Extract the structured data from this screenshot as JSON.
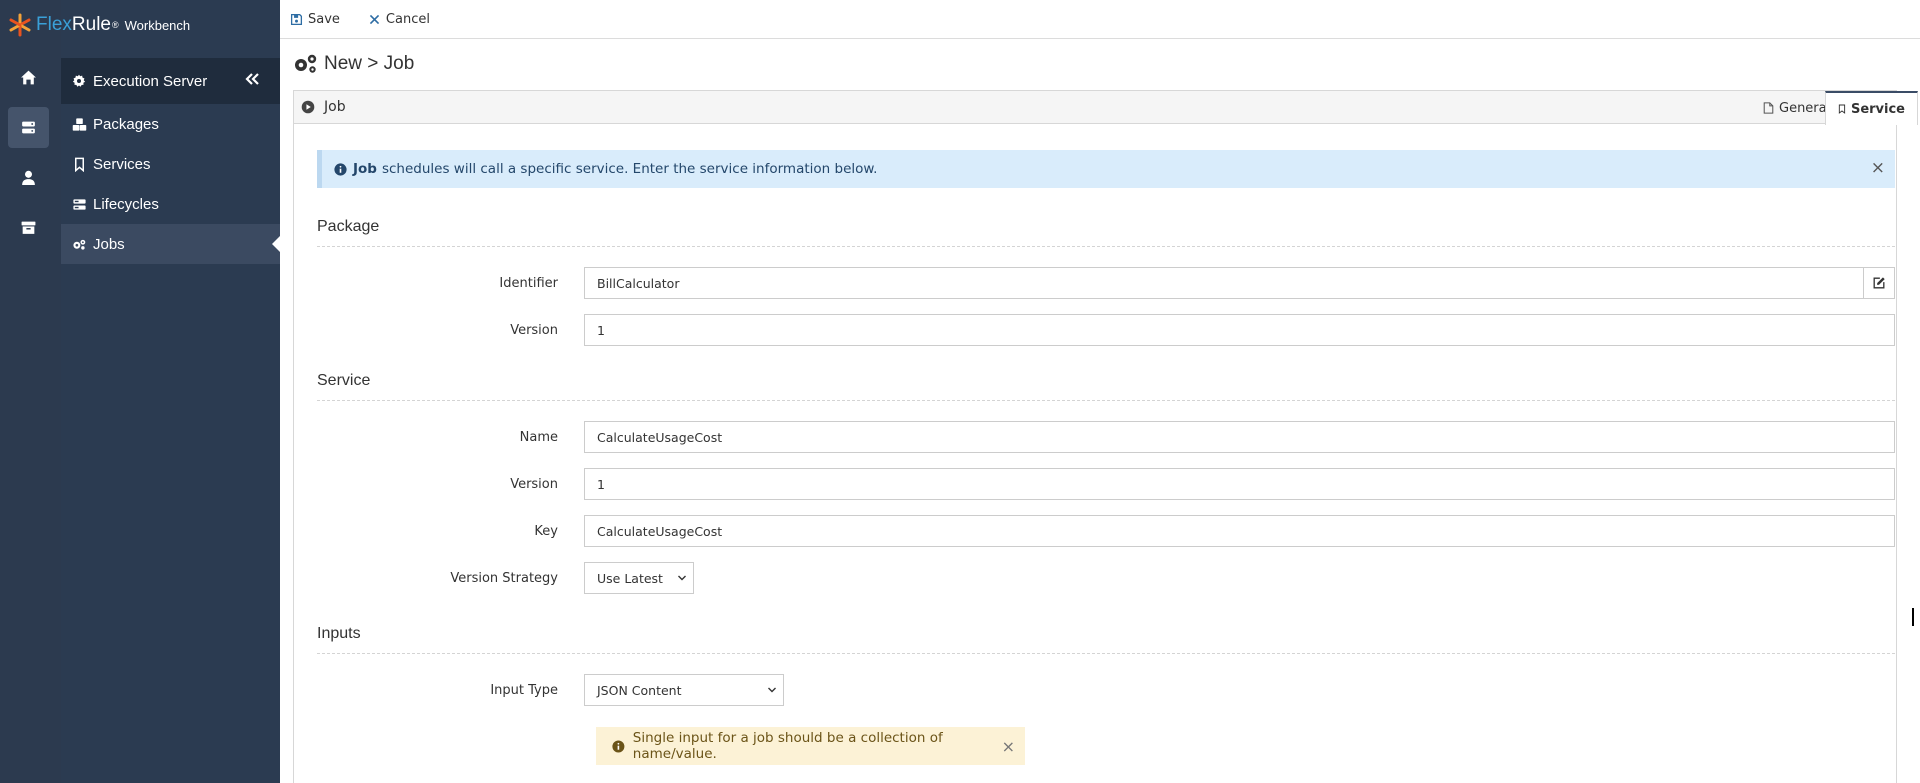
{
  "brand": {
    "name_flex": "Flex",
    "name_rule": "Rule",
    "registered": "®",
    "product": "Workbench"
  },
  "rail": {
    "items": [
      "home-icon",
      "server-icon",
      "user-icon",
      "archive-icon"
    ],
    "active_index": 1
  },
  "sidebar": {
    "header": "Execution Server",
    "items": [
      {
        "label": "Packages",
        "icon": "packages-icon"
      },
      {
        "label": "Services",
        "icon": "bookmark-icon"
      },
      {
        "label": "Lifecycles",
        "icon": "lifecycles-icon"
      },
      {
        "label": "Jobs",
        "icon": "gears-icon"
      }
    ],
    "active": "Jobs"
  },
  "toolbar": {
    "save_label": "Save",
    "cancel_label": "Cancel"
  },
  "page_title": "New > Job",
  "panel": {
    "title": "Job",
    "tabs": [
      {
        "label": "General",
        "active": false
      },
      {
        "label": "Service",
        "active": true
      }
    ]
  },
  "alert": {
    "bold": "Job",
    "text": "schedules will call a specific service. Enter the service information below.",
    "close": "×"
  },
  "sections": {
    "package": {
      "title": "Package",
      "identifier_label": "Identifier",
      "identifier_value": "BillCalculator",
      "version_label": "Version",
      "version_value": "1"
    },
    "service": {
      "title": "Service",
      "name_label": "Name",
      "name_value": "CalculateUsageCost",
      "version_label": "Version",
      "version_value": "1",
      "key_label": "Key",
      "key_value": "CalculateUsageCost",
      "strategy_label": "Version Strategy",
      "strategy_value": "Use Latest"
    },
    "inputs": {
      "title": "Inputs",
      "type_label": "Input Type",
      "type_value": "JSON Content",
      "warning": "Single input for a job should be a collection of name/value.",
      "warning_close": "×"
    }
  },
  "colors": {
    "rail_bg": "#2c3a4f",
    "sidebar_bg": "#2b3b51",
    "sidebar_header_bg": "#1f2c3d",
    "alert_bg": "#d9ecfb",
    "warning_bg": "#fcf2d6",
    "brand_blue": "#3aa0d8"
  }
}
